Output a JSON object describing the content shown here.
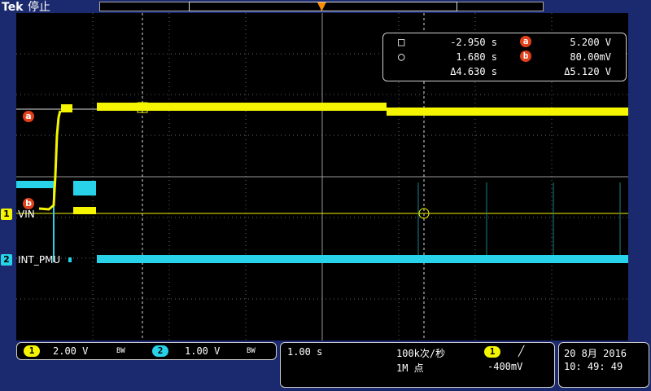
{
  "header": {
    "brand": "Tek",
    "status": "停止"
  },
  "channels": [
    {
      "id": "1",
      "name": "VIN",
      "color": "#f5f500"
    },
    {
      "id": "2",
      "name": "INT_PMU",
      "color": "#28d2e8"
    }
  ],
  "cursor_markers": {
    "a": "a",
    "b": "b",
    "color": "#e2401b"
  },
  "cursor_readout": {
    "time1": "-2.950 s",
    "time2": "1.680 s",
    "delta_time": "Δ4.630 s",
    "volt_a": "5.200 V",
    "volt_b": "80.00mV",
    "delta_volt": "Δ5.120 V",
    "label_a": "a",
    "label_b": "b"
  },
  "vertical": {
    "ch1_scale": "2.00 V",
    "ch1_bw": "BW",
    "ch2_scale": "1.00 V",
    "ch2_bw": "BW"
  },
  "horizontal": {
    "time_scale": "1.00 s",
    "sample_rate": "100k次/秒",
    "record_length": "1M 点",
    "trigger_channel": "1",
    "trigger_slope": "╱",
    "trigger_level": "-400mV"
  },
  "datetime": {
    "date": "20 8月  2016",
    "time": "10: 49: 49"
  },
  "colors": {
    "ch1": "#f5f500",
    "ch2": "#28d2e8",
    "trigger": "#ff8c00",
    "background": "#1b2a6e"
  }
}
